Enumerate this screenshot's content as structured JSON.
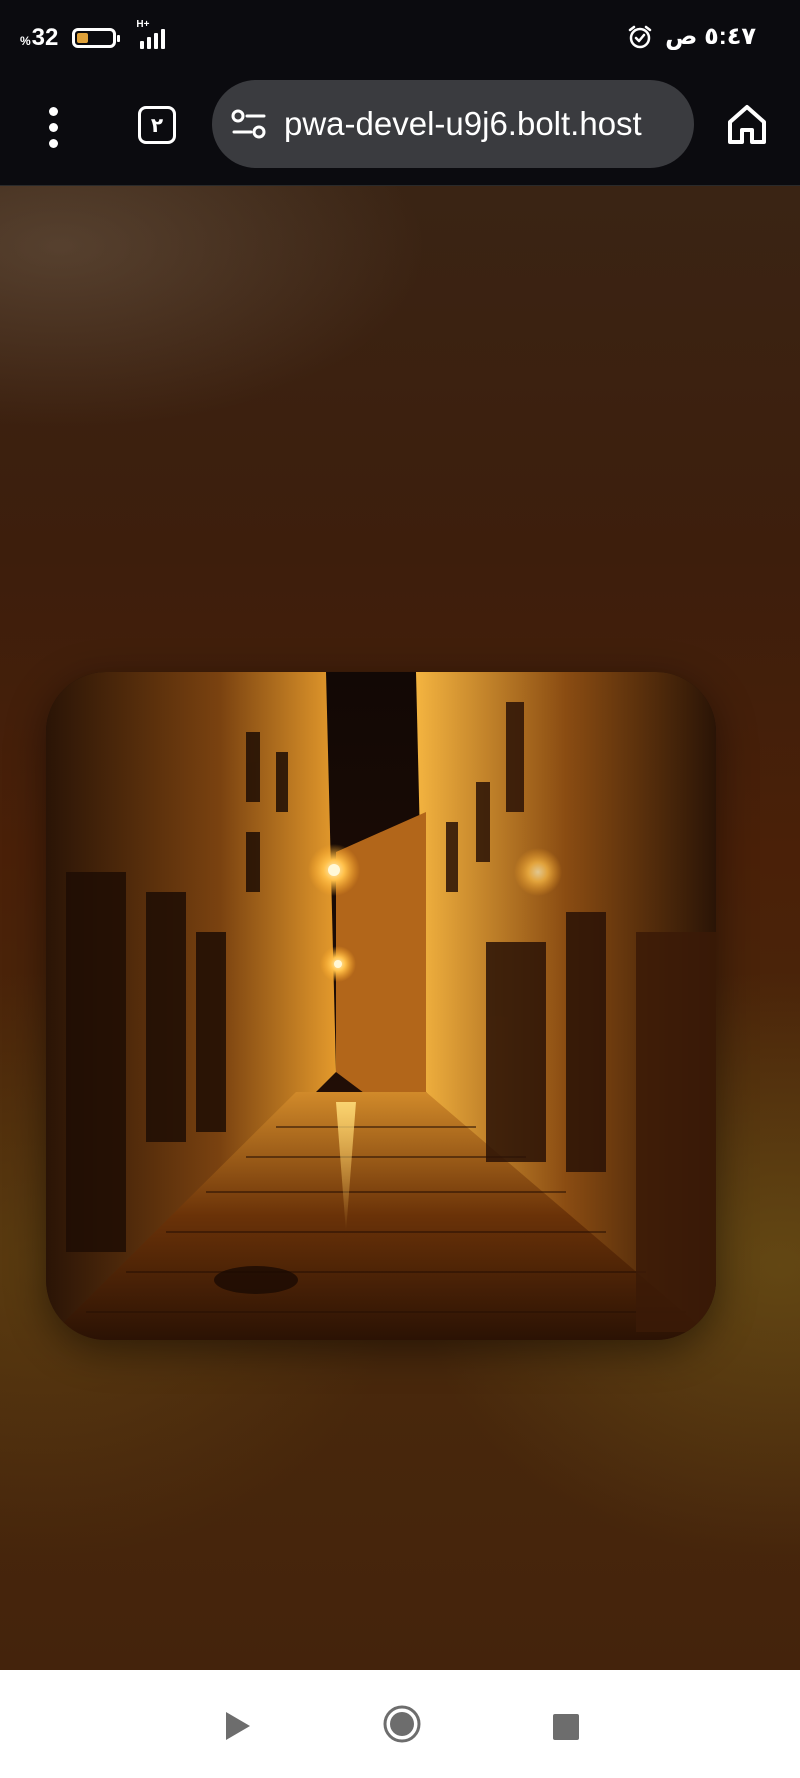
{
  "status_bar": {
    "battery_percent": "32",
    "battery_percent_sign": "%",
    "battery_level": 0.32,
    "network_type": "H+",
    "time": "٥:٤٧ ص",
    "battery_fill_color": "#e0a23a"
  },
  "browser": {
    "menu_icon": "more-vert-icon",
    "tab_count": "٢",
    "site_settings_icon": "tune-icon",
    "url": "pwa-devel-u9j6.bolt.host",
    "home_icon": "home-icon"
  },
  "page": {
    "image_description_icon": "night-alley-photo"
  },
  "nav_bar": {
    "back_icon": "back-triangle-icon",
    "home_icon": "home-circle-icon",
    "recents_icon": "recents-square-icon"
  }
}
